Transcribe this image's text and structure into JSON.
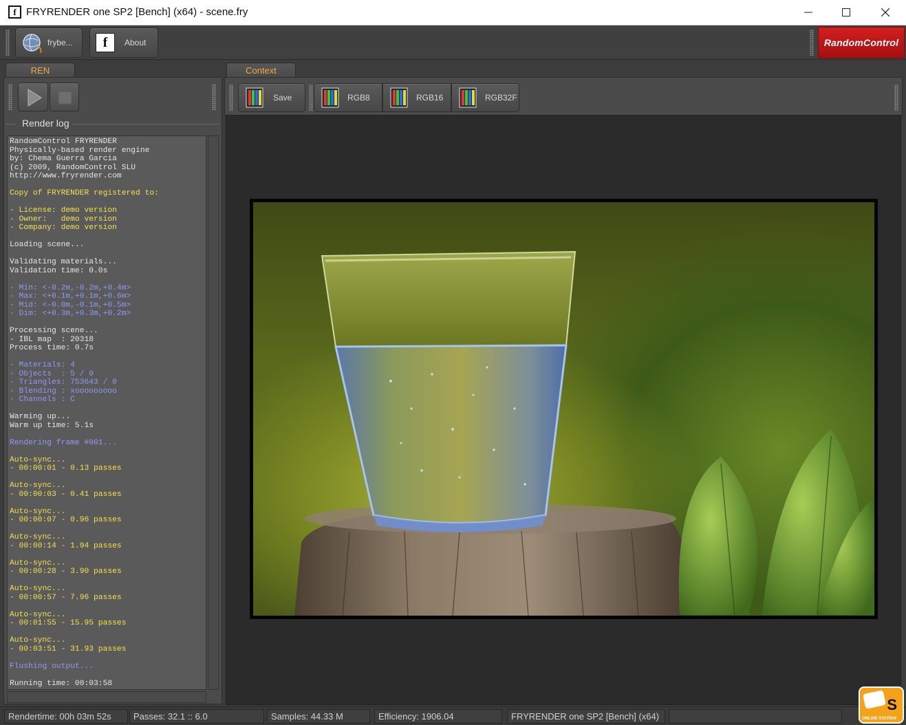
{
  "window": {
    "title": "FRYRENDER one SP2 [Bench] (x64) - scene.fry",
    "app_icon": "f"
  },
  "toolbar": {
    "frybe_label": "frybe...",
    "about_label": "About",
    "about_icon": "f",
    "logo_text": "RandomControl"
  },
  "left_panel": {
    "tab_label": "REN",
    "group_label": "Render log"
  },
  "right_panel": {
    "tab_label": "Context",
    "buttons": {
      "save": "Save",
      "rgb8": "RGB8",
      "rgb16": "RGB16",
      "rgb32f": "RGB32F"
    }
  },
  "render_log": [
    {
      "t": "RandomControl FRYRENDER",
      "c": "w"
    },
    {
      "t": "Physically-based render engine",
      "c": "w"
    },
    {
      "t": "by: Chema Guerra Garcia",
      "c": "w"
    },
    {
      "t": "(c) 2009, RandomControl SLU",
      "c": "w"
    },
    {
      "t": "http://www.fryrender.com",
      "c": "w"
    },
    {
      "t": "",
      "c": "w"
    },
    {
      "t": "Copy of FRYRENDER registered to:",
      "c": "y"
    },
    {
      "t": "",
      "c": "w"
    },
    {
      "t": "- License: demo version",
      "c": "y"
    },
    {
      "t": "- Owner:   demo version",
      "c": "y"
    },
    {
      "t": "- Company: demo version",
      "c": "y"
    },
    {
      "t": "",
      "c": "w"
    },
    {
      "t": "Loading scene...",
      "c": "w"
    },
    {
      "t": "",
      "c": "w"
    },
    {
      "t": "Validating materials...",
      "c": "w"
    },
    {
      "t": "Validation time: 0.0s",
      "c": "w"
    },
    {
      "t": "",
      "c": "w"
    },
    {
      "t": "- Min: <-0.2m,-0.2m,+0.4m>",
      "c": "b"
    },
    {
      "t": "- Max: <+0.1m,+0.1m,+0.6m>",
      "c": "b"
    },
    {
      "t": "- Mid: <-0.0m,-0.1m,+0.5m>",
      "c": "b"
    },
    {
      "t": "- Dim: <+0.3m,+0.3m,+0.2m>",
      "c": "b"
    },
    {
      "t": "",
      "c": "w"
    },
    {
      "t": "Processing scene...",
      "c": "w"
    },
    {
      "t": "- IBL map  : 20318",
      "c": "w"
    },
    {
      "t": "Process time: 0.7s",
      "c": "w"
    },
    {
      "t": "",
      "c": "w"
    },
    {
      "t": "- Materials: 4",
      "c": "b"
    },
    {
      "t": "- Objects  : 5 / 0",
      "c": "b"
    },
    {
      "t": "- Triangles: 753643 / 0",
      "c": "b"
    },
    {
      "t": "- Blending : xooooooooo",
      "c": "b"
    },
    {
      "t": "- Channels : C",
      "c": "b"
    },
    {
      "t": "",
      "c": "w"
    },
    {
      "t": "Warming up...",
      "c": "w"
    },
    {
      "t": "Warm up time: 5.1s",
      "c": "w"
    },
    {
      "t": "",
      "c": "w"
    },
    {
      "t": "Rendering frame #001...",
      "c": "b"
    },
    {
      "t": "",
      "c": "w"
    },
    {
      "t": "Auto-sync...",
      "c": "y"
    },
    {
      "t": "- 00:00:01 - 0.13 passes",
      "c": "y"
    },
    {
      "t": "",
      "c": "w"
    },
    {
      "t": "Auto-sync...",
      "c": "y"
    },
    {
      "t": "- 00:00:03 - 0.41 passes",
      "c": "y"
    },
    {
      "t": "",
      "c": "w"
    },
    {
      "t": "Auto-sync...",
      "c": "y"
    },
    {
      "t": "- 00:00:07 - 0.96 passes",
      "c": "y"
    },
    {
      "t": "",
      "c": "w"
    },
    {
      "t": "Auto-sync...",
      "c": "y"
    },
    {
      "t": "- 00:00:14 - 1.94 passes",
      "c": "y"
    },
    {
      "t": "",
      "c": "w"
    },
    {
      "t": "Auto-sync...",
      "c": "y"
    },
    {
      "t": "- 00:00:28 - 3.90 passes",
      "c": "y"
    },
    {
      "t": "",
      "c": "w"
    },
    {
      "t": "Auto-sync...",
      "c": "y"
    },
    {
      "t": "- 00:00:57 - 7.96 passes",
      "c": "y"
    },
    {
      "t": "",
      "c": "w"
    },
    {
      "t": "Auto-sync...",
      "c": "y"
    },
    {
      "t": "- 00:01:55 - 15.95 passes",
      "c": "y"
    },
    {
      "t": "",
      "c": "w"
    },
    {
      "t": "Auto-sync...",
      "c": "y"
    },
    {
      "t": "- 00:03:51 - 31.93 passes",
      "c": "y"
    },
    {
      "t": "",
      "c": "w"
    },
    {
      "t": "Flushing output...",
      "c": "b"
    },
    {
      "t": "",
      "c": "w"
    },
    {
      "t": "Running time: 00:03:58",
      "c": "w"
    }
  ],
  "status": {
    "rendertime": "Rendertime:  00h 03m 52s",
    "passes": "Passes:  32.1 :: 6.0",
    "samples": "Samples:  44.33 M",
    "efficiency": "Efficiency:  1906.04",
    "version": "FRYRENDER one SP2 [Bench] (x64)"
  },
  "badge": {
    "letter": "S",
    "text": "ONLINE STATION"
  },
  "colors": {
    "tab_label": "#f0a848",
    "log_white": "#e6e6e6",
    "log_yellow": "#f2e14a",
    "log_blue": "#8f9af5",
    "logo_red": "#c41818"
  }
}
